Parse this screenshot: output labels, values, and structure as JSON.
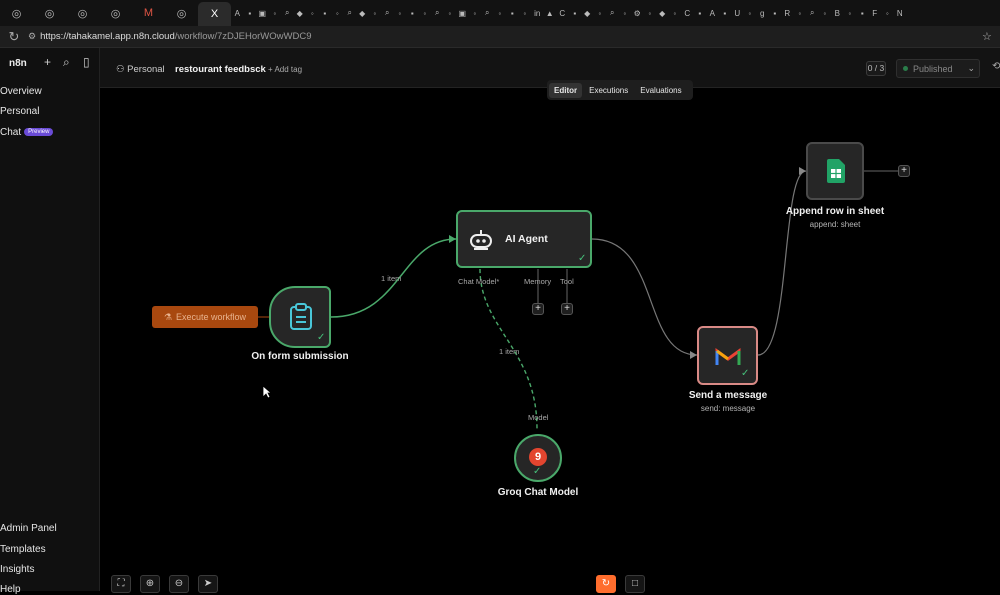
{
  "browser": {
    "active_tab_label": "X",
    "url_host": "https://tahakamel.app.n8n.cloud",
    "url_path": "/workflow/7zDJEHorWOwWDC9"
  },
  "sidebar": {
    "brand": "n8n",
    "items": [
      {
        "label": "Overview"
      },
      {
        "label": "Personal"
      },
      {
        "label": "Chat",
        "badge": "Preview"
      },
      {
        "label": "Admin Panel"
      },
      {
        "label": "Templates"
      },
      {
        "label": "Insights"
      },
      {
        "label": "Help"
      }
    ]
  },
  "header": {
    "project": "Personal",
    "workflow_name": "restourant feedbsck",
    "add_tag": "+ Add tag",
    "counter": "0 / 3",
    "publish_state": "Published"
  },
  "view_tabs": [
    {
      "label": "Editor",
      "active": true
    },
    {
      "label": "Executions",
      "active": false
    },
    {
      "label": "Evaluations",
      "active": false
    }
  ],
  "workflow": {
    "execute_button": "Execute workflow",
    "nodes": {
      "trigger": {
        "title": "On form submission",
        "icon": "clipboard-icon",
        "status": "success"
      },
      "agent": {
        "title": "AI Agent",
        "icon": "robot-icon",
        "status": "success",
        "ports": [
          "Chat Model*",
          "Memory",
          "Tool"
        ]
      },
      "groq": {
        "title": "Groq Chat Model",
        "icon": "groq-logo",
        "status": "success",
        "port": "Model"
      },
      "gmail": {
        "title": "Send a message",
        "subtitle": "send: message",
        "icon": "gmail-logo",
        "status": "success"
      },
      "sheets": {
        "title": "Append row in sheet",
        "subtitle": "append: sheet",
        "icon": "sheets-logo"
      }
    },
    "edge_labels": {
      "trigger_to_agent": "1 item",
      "model_to_agent": "1 item"
    }
  },
  "colors": {
    "success": "#46c07a",
    "execute": "#a8480f",
    "gmail_border": "#d98a86",
    "sheets": "#21a366"
  }
}
